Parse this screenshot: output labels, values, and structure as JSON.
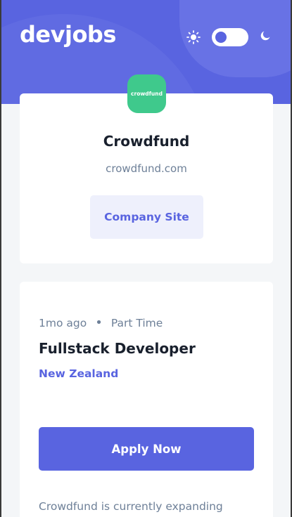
{
  "header": {
    "logo": "devjobs",
    "theme": {
      "sun_icon": "sun-icon",
      "moon_icon": "moon-icon",
      "dark_mode": false
    }
  },
  "company": {
    "logo_text": "crowdfund",
    "logo_color": "#3fc98c",
    "name": "Crowdfund",
    "url": "crowdfund.com",
    "site_button_label": "Company Site"
  },
  "job": {
    "posted": "1mo ago",
    "separator": "•",
    "contract": "Part Time",
    "title": "Fullstack Developer",
    "location": "New Zealand",
    "apply_label": "Apply Now",
    "description": "Crowdfund is currently expanding"
  },
  "colors": {
    "accent": "#5964e0",
    "background": "#f4f6f8",
    "text_dark": "#19202d",
    "text_muted": "#6e8098"
  }
}
